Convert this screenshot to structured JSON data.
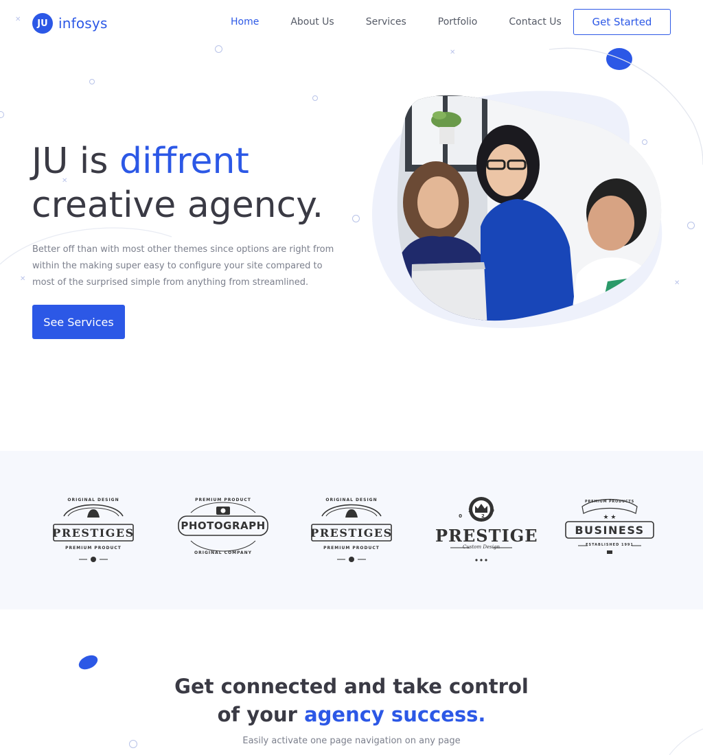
{
  "brand": {
    "badge": "JU",
    "name": "infosys",
    "color": "#2c58e6"
  },
  "nav": {
    "items": [
      {
        "label": "Home",
        "active": true
      },
      {
        "label": "About Us",
        "active": false
      },
      {
        "label": "Services",
        "active": false
      },
      {
        "label": "Portfolio",
        "active": false
      },
      {
        "label": "Contact Us",
        "active": false
      }
    ],
    "cta_label": "Get Started"
  },
  "hero": {
    "title_prefix": "JU is",
    "title_accent": "diffrent",
    "title_line2": "creative agency.",
    "description": "Better off than with most other themes since options are right from within the making super easy to configure your site compared to most of the surprised simple from anything from streamlined.",
    "button_label": "See Services",
    "image_icon": "team-photo-image"
  },
  "partners": {
    "logos": [
      {
        "name": "PRESTIGES",
        "top_text": "ORIGINAL DESIGN",
        "bottom_text": "PREMIUM PRODUCT",
        "icon": "bell-icon"
      },
      {
        "name": "PHOTOGRAPH",
        "top_text": "PREMIUM PRODUCT",
        "bottom_text": "ORIGINAL COMPANY",
        "icon": "camera-icon"
      },
      {
        "name": "PRESTIGES",
        "top_text": "ORIGINAL DESIGN",
        "bottom_text": "PREMIUM PRODUCT",
        "icon": "bell-icon"
      },
      {
        "name": "PRESTIGE",
        "top_text": "20  02",
        "bottom_text": "Custom Design",
        "icon": "crown-icon"
      },
      {
        "name": "BUSINESS",
        "top_text": "PREMIUM PRODUCTS",
        "bottom_text": "ESTABLISHED 1991",
        "icon": "star-icon"
      }
    ]
  },
  "section": {
    "title_line1": "Get connected and take control",
    "title_prefix2": "of your",
    "title_accent": "agency success.",
    "subtitle": "Easily activate one page navigation on any page"
  },
  "colors": {
    "accent": "#2c58e6",
    "text": "#3a3a44",
    "muted": "#7b7f8c",
    "band": "#f6f8fd"
  }
}
